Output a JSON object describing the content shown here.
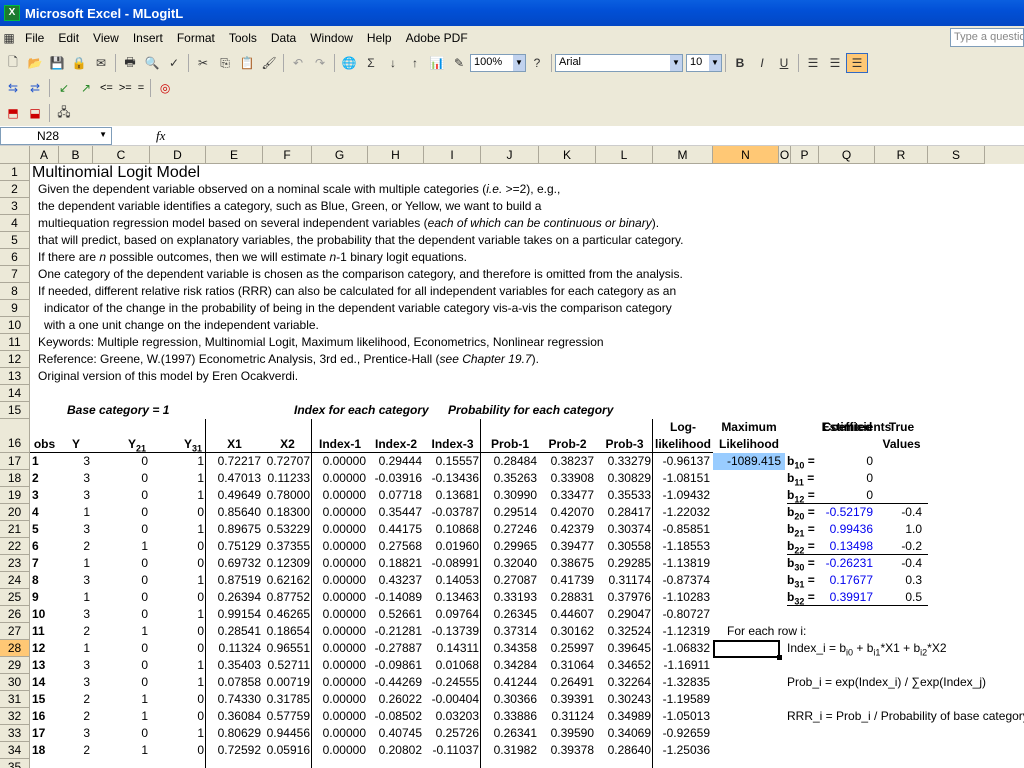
{
  "window": {
    "title": "Microsoft Excel - MLogitL",
    "app_icon": "excel-icon"
  },
  "menu": [
    "File",
    "Edit",
    "View",
    "Insert",
    "Format",
    "Tools",
    "Data",
    "Window",
    "Help",
    "Adobe PDF"
  ],
  "ask_placeholder": "Type a question",
  "toolbar": {
    "zoom": "100%",
    "font": "Arial",
    "size": "10",
    "bold": "B",
    "italic": "I",
    "underline": "U"
  },
  "toolbar2": {
    "le": "<=",
    "ge": ">=",
    "eq": "="
  },
  "namebox": "N28",
  "fx": "fx",
  "columns": [
    "A",
    "B",
    "C",
    "D",
    "E",
    "F",
    "G",
    "H",
    "I",
    "J",
    "K",
    "L",
    "M",
    "N",
    "O",
    "P",
    "Q",
    "R",
    "S"
  ],
  "selected_col": "N",
  "selected_row": 28,
  "text": {
    "title": "Multinomial Logit Model",
    "r2": "Given the dependent variable observed on a nominal scale with multiple categories (",
    "r2i": "i.e.",
    "r2b": " >=2), e.g.,",
    "r3": "the dependent variable identifies a category, such as Blue, Green, or Yellow, we want to build a",
    "r4": "multiequation regression model based on several independent variables (",
    "r4i": "each of which can be continuous or binary",
    "r4b": ").",
    "r5": "that will predict, based on explanatory variables, the probability that the dependent variable takes on a particular category.",
    "r6a": "If there are ",
    "r6n": "n",
    "r6b": " possible outcomes, then we will estimate ",
    "r6n2": "n",
    "r6c": "-1 binary logit equations.",
    "r7": "One category of the dependent variable is chosen as the comparison category, and therefore is omitted from the analysis.",
    "r8": "If needed, different relative risk ratios (RRR) can also be calculated for all independent variables for each category as an",
    "r9": "indicator of the change in the probability of being in the dependent variable category vis-a-vis the comparison category",
    "r10": "with a one unit change on the independent variable.",
    "r11": "Keywords: Multiple regression, Multinomial Logit, Maximum likelihood, Econometrics, Nonlinear regression",
    "r12a": "Reference: Greene, W.(1997) Econometric Analysis, 3rd ed., Prentice-Hall (",
    "r12i": "see Chapter 19.7",
    "r12b": ").",
    "r13": "Original version of this model by Eren Ocakverdi.",
    "base": "Base category = 1",
    "index_hdr": "Index for each category",
    "prob_hdr": "Probability for each category"
  },
  "headers": {
    "obs": "obs",
    "y": "Y",
    "y21": "Y21",
    "y31": "Y31",
    "x1": "X1",
    "x2": "X2",
    "idx1": "Index-1",
    "idx2": "Index-2",
    "idx3": "Index-3",
    "p1": "Prob-1",
    "p2": "Prob-2",
    "p3": "Prob-3",
    "ll1": "Log-",
    "ll2": "likelihood",
    "ml1": "Maximum",
    "ml2": "Likelihood",
    "est1": "Estimted",
    "est2": "Coefficients",
    "tv1": "True",
    "tv2": "Values"
  },
  "max_likelihood": "-1089.415",
  "rows": [
    {
      "obs": "1",
      "y": "3",
      "y21": "0",
      "y31": "1",
      "x1": "0.72217",
      "x2": "0.72707",
      "i1": "0.00000",
      "i2": "0.29444",
      "i3": "0.15557",
      "p1": "0.28484",
      "p2": "0.38237",
      "p3": "0.33279",
      "ll": "-0.96137"
    },
    {
      "obs": "2",
      "y": "3",
      "y21": "0",
      "y31": "1",
      "x1": "0.47013",
      "x2": "0.11233",
      "i1": "0.00000",
      "i2": "-0.03916",
      "i3": "-0.13436",
      "p1": "0.35263",
      "p2": "0.33908",
      "p3": "0.30829",
      "ll": "-1.08151"
    },
    {
      "obs": "3",
      "y": "3",
      "y21": "0",
      "y31": "1",
      "x1": "0.49649",
      "x2": "0.78000",
      "i1": "0.00000",
      "i2": "0.07718",
      "i3": "0.13681",
      "p1": "0.30990",
      "p2": "0.33477",
      "p3": "0.35533",
      "ll": "-1.09432"
    },
    {
      "obs": "4",
      "y": "1",
      "y21": "0",
      "y31": "0",
      "x1": "0.85640",
      "x2": "0.18300",
      "i1": "0.00000",
      "i2": "0.35447",
      "i3": "-0.03787",
      "p1": "0.29514",
      "p2": "0.42070",
      "p3": "0.28417",
      "ll": "-1.22032"
    },
    {
      "obs": "5",
      "y": "3",
      "y21": "0",
      "y31": "1",
      "x1": "0.89675",
      "x2": "0.53229",
      "i1": "0.00000",
      "i2": "0.44175",
      "i3": "0.10868",
      "p1": "0.27246",
      "p2": "0.42379",
      "p3": "0.30374",
      "ll": "-0.85851"
    },
    {
      "obs": "6",
      "y": "2",
      "y21": "1",
      "y31": "0",
      "x1": "0.75129",
      "x2": "0.37355",
      "i1": "0.00000",
      "i2": "0.27568",
      "i3": "0.01960",
      "p1": "0.29965",
      "p2": "0.39477",
      "p3": "0.30558",
      "ll": "-1.18553"
    },
    {
      "obs": "7",
      "y": "1",
      "y21": "0",
      "y31": "0",
      "x1": "0.69732",
      "x2": "0.12309",
      "i1": "0.00000",
      "i2": "0.18821",
      "i3": "-0.08991",
      "p1": "0.32040",
      "p2": "0.38675",
      "p3": "0.29285",
      "ll": "-1.13819"
    },
    {
      "obs": "8",
      "y": "3",
      "y21": "0",
      "y31": "1",
      "x1": "0.87519",
      "x2": "0.62162",
      "i1": "0.00000",
      "i2": "0.43237",
      "i3": "0.14053",
      "p1": "0.27087",
      "p2": "0.41739",
      "p3": "0.31174",
      "ll": "-0.87374"
    },
    {
      "obs": "9",
      "y": "1",
      "y21": "0",
      "y31": "0",
      "x1": "0.26394",
      "x2": "0.87752",
      "i1": "0.00000",
      "i2": "-0.14089",
      "i3": "0.13463",
      "p1": "0.33193",
      "p2": "0.28831",
      "p3": "0.37976",
      "ll": "-1.10283"
    },
    {
      "obs": "10",
      "y": "3",
      "y21": "0",
      "y31": "1",
      "x1": "0.99154",
      "x2": "0.46265",
      "i1": "0.00000",
      "i2": "0.52661",
      "i3": "0.09764",
      "p1": "0.26345",
      "p2": "0.44607",
      "p3": "0.29047",
      "ll": "-0.80727"
    },
    {
      "obs": "11",
      "y": "2",
      "y21": "1",
      "y31": "0",
      "x1": "0.28541",
      "x2": "0.18654",
      "i1": "0.00000",
      "i2": "-0.21281",
      "i3": "-0.13739",
      "p1": "0.37314",
      "p2": "0.30162",
      "p3": "0.32524",
      "ll": "-1.12319"
    },
    {
      "obs": "12",
      "y": "1",
      "y21": "0",
      "y31": "0",
      "x1": "0.11324",
      "x2": "0.96551",
      "i1": "0.00000",
      "i2": "-0.27887",
      "i3": "0.14311",
      "p1": "0.34358",
      "p2": "0.25997",
      "p3": "0.39645",
      "ll": "-1.06832"
    },
    {
      "obs": "13",
      "y": "3",
      "y21": "0",
      "y31": "1",
      "x1": "0.35403",
      "x2": "0.52711",
      "i1": "0.00000",
      "i2": "-0.09861",
      "i3": "0.01068",
      "p1": "0.34284",
      "p2": "0.31064",
      "p3": "0.34652",
      "ll": "-1.16911"
    },
    {
      "obs": "14",
      "y": "3",
      "y21": "0",
      "y31": "1",
      "x1": "0.07858",
      "x2": "0.00719",
      "i1": "0.00000",
      "i2": "-0.44269",
      "i3": "-0.24555",
      "p1": "0.41244",
      "p2": "0.26491",
      "p3": "0.32264",
      "ll": "-1.32835"
    },
    {
      "obs": "15",
      "y": "2",
      "y21": "1",
      "y31": "0",
      "x1": "0.74330",
      "x2": "0.31785",
      "i1": "0.00000",
      "i2": "0.26022",
      "i3": "-0.00404",
      "p1": "0.30366",
      "p2": "0.39391",
      "p3": "0.30243",
      "ll": "-1.19589"
    },
    {
      "obs": "16",
      "y": "2",
      "y21": "1",
      "y31": "0",
      "x1": "0.36084",
      "x2": "0.57759",
      "i1": "0.00000",
      "i2": "-0.08502",
      "i3": "0.03203",
      "p1": "0.33886",
      "p2": "0.31124",
      "p3": "0.34989",
      "ll": "-1.05013"
    },
    {
      "obs": "17",
      "y": "3",
      "y21": "0",
      "y31": "1",
      "x1": "0.80629",
      "x2": "0.94456",
      "i1": "0.00000",
      "i2": "0.40745",
      "i3": "0.25726",
      "p1": "0.26341",
      "p2": "0.39590",
      "p3": "0.34069",
      "ll": "-0.92659"
    },
    {
      "obs": "18",
      "y": "2",
      "y21": "1",
      "y31": "0",
      "x1": "0.72592",
      "x2": "0.05916",
      "i1": "0.00000",
      "i2": "0.20802",
      "i3": "-0.11037",
      "p1": "0.31982",
      "p2": "0.39378",
      "p3": "0.28640",
      "ll": "-1.25036"
    }
  ],
  "coefficients": [
    {
      "label": "b10 =",
      "est": "0",
      "true": "",
      "blue": false
    },
    {
      "label": "b11 =",
      "est": "0",
      "true": "",
      "blue": false
    },
    {
      "label": "b12 =",
      "est": "0",
      "true": "",
      "blue": false
    },
    {
      "label": "b20 =",
      "est": "-0.52179",
      "true": "-0.4",
      "blue": true
    },
    {
      "label": "b21 =",
      "est": "0.99436",
      "true": "1.0",
      "blue": true
    },
    {
      "label": "b22 =",
      "est": "0.13498",
      "true": "-0.2",
      "blue": true
    },
    {
      "label": "b30 =",
      "est": "-0.26231",
      "true": "-0.4",
      "blue": true
    },
    {
      "label": "b31 =",
      "est": "0.17677",
      "true": "0.3",
      "blue": true
    },
    {
      "label": "b32 =",
      "est": "0.39917",
      "true": "0.5",
      "blue": true
    }
  ],
  "notes": {
    "for_each": "For each row i:",
    "index_formula": "Index_i = bi0 + bi1*X1 + bi2*X2",
    "prob_formula": "Prob_i = exp(Index_i) / ∑exp(Index_j)",
    "rrr_formula": "RRR_i = Prob_i / Probability of base category"
  },
  "colors": {
    "title_blue": "#0250d6",
    "selection": "#ffc875",
    "toolbar": "#ece9d8",
    "coef_blue": "#0000ee",
    "ml_cell": "#99ccff"
  }
}
